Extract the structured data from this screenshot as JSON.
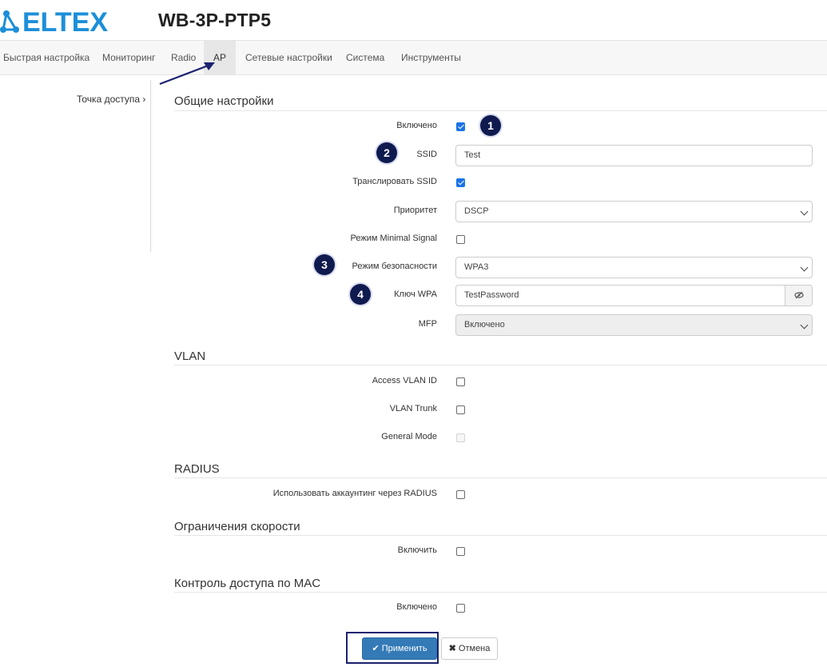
{
  "header": {
    "logo_text": "ELTEX",
    "device_name": "WB-3P-PTP5"
  },
  "nav": {
    "items": [
      "Быстрая настройка",
      "Мониторинг",
      "Radio",
      "AP",
      "Сетевые настройки",
      "Система",
      "Инструменты"
    ],
    "active": "AP"
  },
  "sidebar": {
    "link_label": "Точка доступа",
    "chevron": "›"
  },
  "general": {
    "title": "Общие настройки",
    "enabled_label": "Включено",
    "enabled": true,
    "ssid_label": "SSID",
    "ssid_value": "Test",
    "broadcast_label": "Транслировать SSID",
    "broadcast": true,
    "priority_label": "Приоритет",
    "priority_value": "DSCP",
    "minimal_signal_label": "Режим Minimal Signal",
    "minimal_signal": false,
    "security_label": "Режим безопасности",
    "security_value": "WPA3",
    "wpa_key_label": "Ключ WPA",
    "wpa_key_value": "TestPassword",
    "mfp_label": "MFP",
    "mfp_value": "Включено"
  },
  "vlan": {
    "title": "VLAN",
    "access_vlan_label": "Access VLAN ID",
    "vlan_trunk_label": "VLAN Trunk",
    "general_mode_label": "General Mode"
  },
  "radius": {
    "title": "RADIUS",
    "accounting_label": "Использовать аккаунтинг через RADIUS"
  },
  "speed_limit": {
    "title": "Ограничения скорости",
    "enable_label": "Включить"
  },
  "mac_control": {
    "title": "Контроль доступа по MAC",
    "enabled_label": "Включено"
  },
  "buttons": {
    "apply_label": "Применить",
    "apply_icon": "✔",
    "cancel_label": "Отмена",
    "cancel_icon": "✖"
  },
  "annotations": [
    "1",
    "2",
    "3",
    "4"
  ],
  "colors": {
    "accent": "#337ab7",
    "badge": "#0f1a4f",
    "logo": "#1c8fd9",
    "checkbox_checked": "#1a73e8"
  }
}
